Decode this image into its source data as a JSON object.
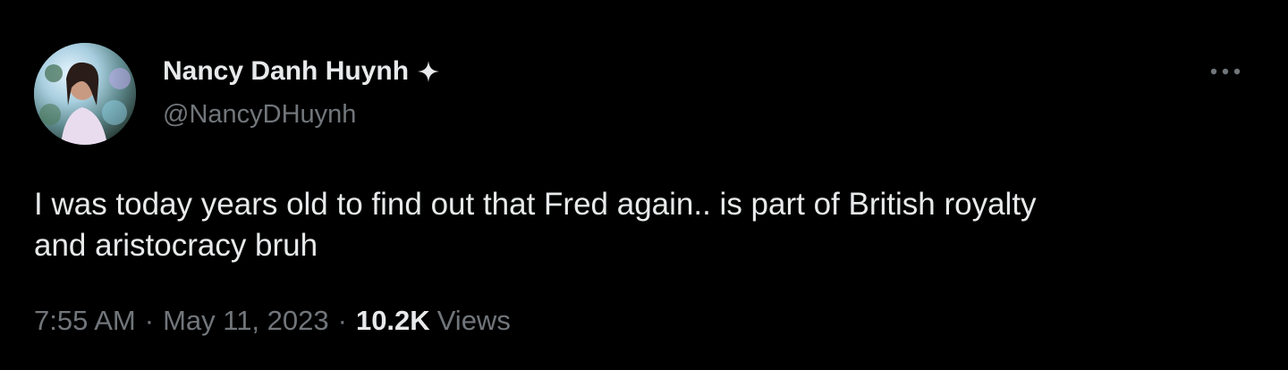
{
  "author": {
    "display_name": "Nancy Danh Huynh",
    "handle": "@NancyDHuynh",
    "badge_icon": "sparkle-icon",
    "avatar": "profile-photo"
  },
  "tweet": {
    "text": "I was today years old to find out that Fred again.. is part of British royalty\nand aristocracy bruh"
  },
  "meta": {
    "time": "7:55 AM",
    "separator": "·",
    "date": "May 11, 2023",
    "views_count": "10.2K",
    "views_label": "Views"
  },
  "more_menu_icon": "more-horizontal-icon",
  "colors": {
    "background": "#000000",
    "primary_text": "#e7e9ea",
    "secondary_text": "#71767b"
  }
}
